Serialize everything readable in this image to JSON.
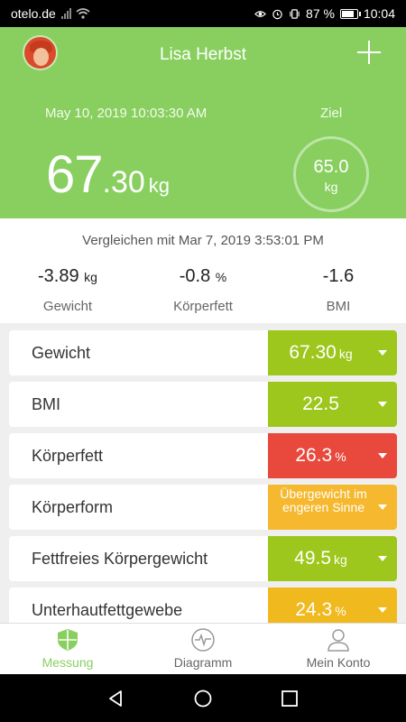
{
  "status_bar": {
    "carrier": "otelo.de",
    "battery": "87 %",
    "time": "10:04"
  },
  "header": {
    "user_name": "Lisa Herbst",
    "measurement_date": "May 10, 2019 10:03:30 AM",
    "weight_int": "67",
    "weight_dec": ".30",
    "weight_unit": "kg",
    "goal_label": "Ziel",
    "goal_value": "65.0",
    "goal_unit": "kg",
    "accent_color": "#88cf5f"
  },
  "comparison": {
    "label": "Vergleichen mit Mar 7, 2019 3:53:01 PM",
    "stats": [
      {
        "value": "-3.89",
        "unit": "kg",
        "label": "Gewicht"
      },
      {
        "value": "-0.8",
        "unit": "%",
        "label": "Körperfett"
      },
      {
        "value": "-1.6",
        "unit": "",
        "label": "BMI"
      }
    ]
  },
  "metrics": [
    {
      "label": "Gewicht",
      "value": "67.30",
      "unit": "kg",
      "color": "#9dc71c"
    },
    {
      "label": "BMI",
      "value": "22.5",
      "unit": "",
      "color": "#9dc71c"
    },
    {
      "label": "Körperfett",
      "value": "26.3",
      "unit": "%",
      "color": "#e8493c"
    },
    {
      "label": "Körperform",
      "value": "Übergewicht im engeren Sinne",
      "unit": "",
      "color": "#f5b82e"
    },
    {
      "label": "Fettfreies Körpergewicht",
      "value": "49.5",
      "unit": "kg",
      "color": "#9dc71c"
    },
    {
      "label": "Unterhautfettgewebe",
      "value": "24.3",
      "unit": "%",
      "color": "#f0b91e"
    }
  ],
  "bottom_nav": [
    {
      "label": "Messung",
      "icon": "shield-icon",
      "active": true
    },
    {
      "label": "Diagramm",
      "icon": "pulse-icon",
      "active": false
    },
    {
      "label": "Mein Konto",
      "icon": "person-icon",
      "active": false
    }
  ]
}
